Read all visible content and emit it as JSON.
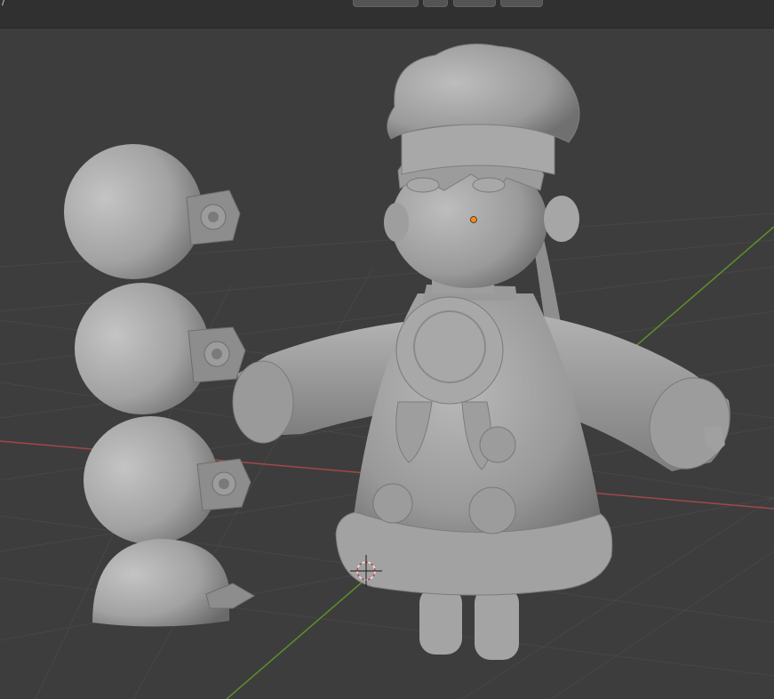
{
  "header": {
    "left_glyph": "/"
  },
  "viewport": {
    "background_color": "#3d3d3d",
    "grid_color": "#484848",
    "x_axis_color": "#b04a4a",
    "y_axis_color": "#6a9a2c",
    "model_color": "#8f8f8f",
    "origin_dot_color": "#f08a20",
    "objects": [
      "chef-character-model",
      "hair-bun-sphere-1",
      "hair-bun-sphere-2",
      "hair-bun-sphere-3",
      "hair-bun-sphere-4",
      "3d-cursor"
    ]
  }
}
